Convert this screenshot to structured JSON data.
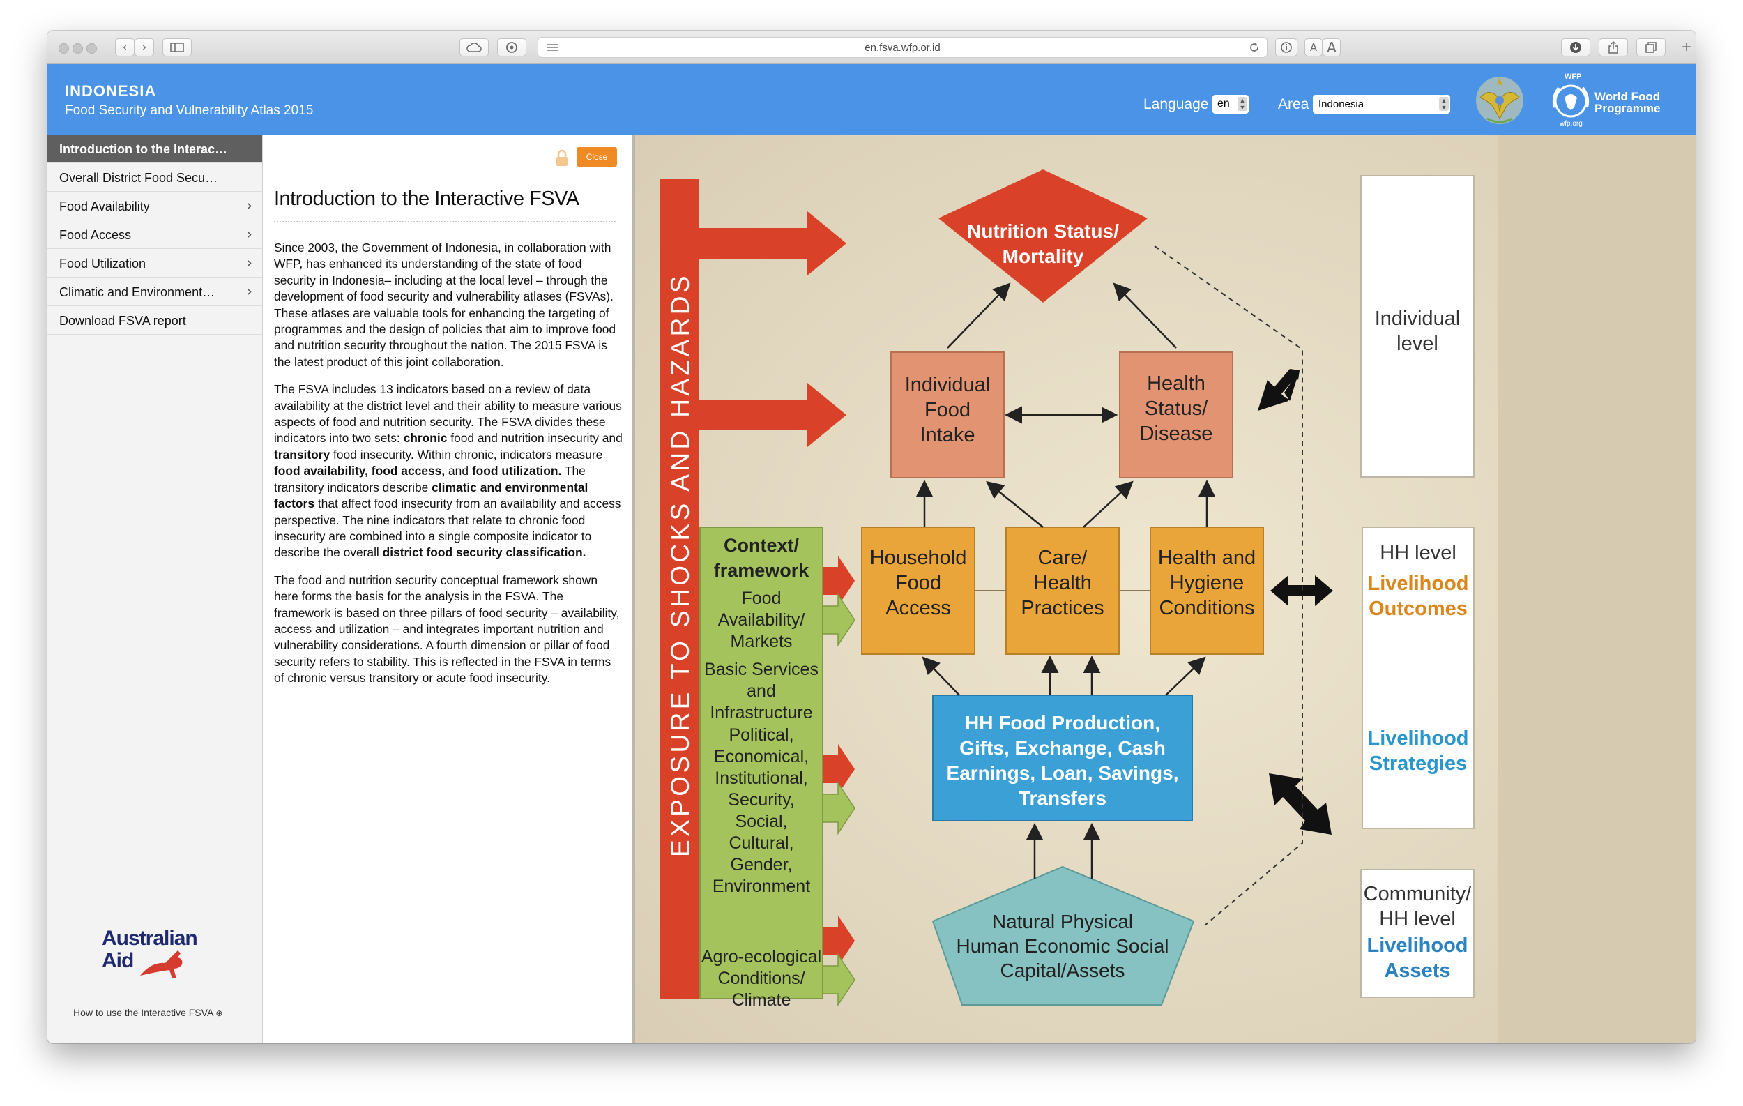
{
  "browser": {
    "url": "en.fsva.wfp.or.id",
    "text_size_small": "A",
    "text_size_large": "A"
  },
  "header": {
    "country": "INDONESIA",
    "subtitle": "Food Security and Vulnerability Atlas 2015",
    "language_label": "Language",
    "language_value": "en",
    "area_label": "Area",
    "area_value": "Indonesia",
    "wfp_top": "WFP",
    "wfp_name_line1": "World Food",
    "wfp_name_line2": "Programme",
    "wfp_url": "wfp.org"
  },
  "sidebar": {
    "items": [
      {
        "label": "Introduction to the Interac…",
        "active": true,
        "has_submenu": false
      },
      {
        "label": "Overall District Food Secu…",
        "active": false,
        "has_submenu": false
      },
      {
        "label": "Food Availability",
        "active": false,
        "has_submenu": true
      },
      {
        "label": "Food Access",
        "active": false,
        "has_submenu": true
      },
      {
        "label": "Food Utilization",
        "active": false,
        "has_submenu": true
      },
      {
        "label": "Climatic and Environment…",
        "active": false,
        "has_submenu": true
      },
      {
        "label": "Download FSVA report",
        "active": false,
        "has_submenu": false
      }
    ],
    "sponsor_line1": "Australian",
    "sponsor_line2": "Aid",
    "help_link": "How to use the Interactive FSVA"
  },
  "panel": {
    "close_label": "Close",
    "title": "Introduction to the Interactive FSVA",
    "p1": "Since 2003, the Government of Indonesia, in collaboration with WFP, has enhanced its understanding of the state of food security in Indonesia– including at the local level – through the development of food security and vulnerability atlases (FSVAs). These atlases are valuable tools for enhancing the targeting of programmes and the design of policies that aim to improve food and nutrition security throughout the nation. The 2015 FSVA is the latest product of this joint collaboration.",
    "p2": {
      "t1": "The FSVA includes 13 indicators based on a review of data availability at the district level and their ability to measure various aspects of food and nutrition security. The FSVA divides these indicators into two sets: ",
      "b1": "chronic",
      "t2": " food and nutrition insecurity and ",
      "b2": "transitory",
      "t3": " food insecurity. Within chronic, indicators measure ",
      "b3": "food availability, food access,",
      "t4": " and ",
      "b4": "food utilization.",
      "t5": " The transitory indicators describe ",
      "b5": "climatic and environmental factors",
      "t6": " that affect food insecurity from an availability and access perspective. The nine indicators that relate to chronic food insecurity are combined into a single composite indicator to describe the overall ",
      "b6": "district food security classification."
    },
    "p3": "The food and nutrition security conceptual framework shown here forms the basis for the analysis in the FSVA. The framework is based on three pillars of food security – availability, access and utilization – and integrates important nutrition and vulnerability considerations. A fourth dimension or pillar of food security refers to stability. This is reflected in the FSVA in terms of chronic versus transitory or acute food insecurity."
  },
  "framework": {
    "exposure_label": "EXPOSURE TO SHOCKS AND HAZARDS",
    "context_title": [
      "Context/",
      "framework"
    ],
    "context_food": [
      "Food",
      "Availability/",
      "Markets"
    ],
    "context_basic": [
      "Basic Services",
      "and",
      "Infrastructure"
    ],
    "context_political": [
      "Political,",
      "Economical,",
      "Institutional,",
      "Security,",
      "Social,",
      "Cultural,",
      "Gender,",
      "Environment"
    ],
    "context_agro": [
      "Agro-ecological",
      "Conditions/",
      "Climate"
    ],
    "nutrition": [
      "Nutrition Status/",
      "Mortality"
    ],
    "individual_food_intake": [
      "Individual",
      "Food",
      "Intake"
    ],
    "health_status": [
      "Health",
      "Status/",
      "Disease"
    ],
    "household_food_access": [
      "Household",
      "Food",
      "Access"
    ],
    "care_health": [
      "Care/",
      "Health",
      "Practices"
    ],
    "health_hygiene": [
      "Health and",
      "Hygiene",
      "Conditions"
    ],
    "hh_food_production": [
      "HH Food Production,",
      "Gifts, Exchange, Cash",
      "Earnings, Loan, Savings,",
      "Transfers"
    ],
    "capital_assets": [
      "Natural Physical",
      "Human Economic Social",
      "Capital/Assets"
    ],
    "individual_level": [
      "Individual",
      "level"
    ],
    "hh_level": "HH level",
    "livelihood_outcomes": [
      "Livelihood",
      "Outcomes"
    ],
    "livelihood_strategies": [
      "Livelihood",
      "Strategies"
    ],
    "community_level": [
      "Community/",
      "HH level"
    ],
    "livelihood_assets": [
      "Livelihood",
      "Assets"
    ],
    "colors": {
      "red": "#d94128",
      "green": "#a4c35c",
      "orange": "#e9a53a",
      "salmon": "#e29372",
      "blue": "#3ba0d6",
      "teal": "#86c2c1",
      "outcomes": "#d9861d",
      "strategies": "#2a96cc",
      "assets": "#2a82c0",
      "header_blue": "#4a93e6"
    }
  }
}
